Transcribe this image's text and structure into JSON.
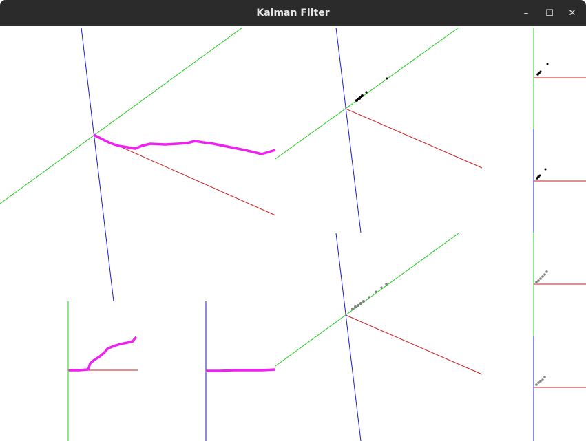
{
  "window": {
    "title": "Kalman Filter",
    "minimize_glyph": "–",
    "maximize_glyph": "☐",
    "close_glyph": "✕"
  },
  "colors": {
    "titlebar": "#2b2b2b",
    "axis_x": "#c81e1e",
    "axis_y": "#1fcc1f",
    "axis_z": "#1a1acc",
    "trajectory": "#ee22ee",
    "black_points": "#000000",
    "gray_points": "#808080"
  },
  "icons": [
    "minimize-icon",
    "maximize-icon",
    "close-icon"
  ]
}
